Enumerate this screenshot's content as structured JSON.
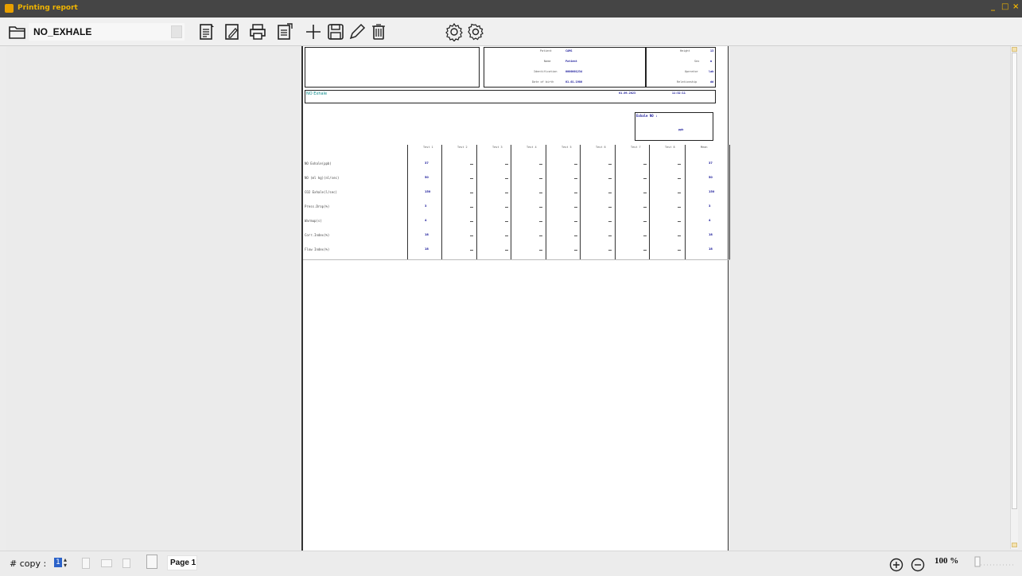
{
  "window": {
    "title": "Printing report",
    "controls": [
      "_",
      "□",
      "×"
    ]
  },
  "toolbar": {
    "report_name": "NO_EXHALE",
    "icons": [
      "folder-open-icon",
      "doc-text-icon",
      "doc-edit-icon",
      "printer-icon",
      "doc-export-icon",
      "plus-icon",
      "save-icon",
      "pencil-icon",
      "trash-icon",
      "settings-cog-icon",
      "settings-gear-icon"
    ]
  },
  "report": {
    "header_labels": {
      "r1": "Patient",
      "r2": "Name",
      "r3": "Identification",
      "r4": "Date of birth",
      "r5": "Height",
      "r6": "Sex",
      "r7": "Operator",
      "r8": "Relationship"
    },
    "header_values": {
      "v1": "CAMS",
      "v2": "Patient",
      "v3": "0000001234",
      "v4": "01.01.1980",
      "v5": "13",
      "v6": "m",
      "v7": "lab",
      "v8": "dd"
    },
    "section_title": "NO Exhale",
    "section_date": "01.09.2023",
    "section_time": "11:32:11",
    "result_label": "Exhale NO :",
    "result_unit": "ppb",
    "col_headers": [
      "Test 1",
      "Test 2",
      "Test 3",
      "Test 4",
      "Test 5",
      "Test 6",
      "Test 7",
      "Test 8",
      "Mean"
    ],
    "rows": [
      {
        "label": "NO Exhale(ppb)",
        "v1": "37",
        "mean": "37"
      },
      {
        "label": "NO (ml kg)(nl/sec)",
        "v1": "50",
        "mean": "50"
      },
      {
        "label": "CO2 Exhale(l/sec)",
        "v1": "150",
        "mean": "150"
      },
      {
        "label": "Press.Drop(%)",
        "v1": "3",
        "mean": "3"
      },
      {
        "label": "Warmup(s)",
        "v1": "4",
        "mean": "4"
      },
      {
        "label": "Corr.Index(%)",
        "v1": "18",
        "mean": "18"
      },
      {
        "label": "Flow Index(%)",
        "v1": "18",
        "mean": "18"
      }
    ],
    "dash": "—"
  },
  "statusbar": {
    "copy_label": "# copy :",
    "copy_value": "1",
    "page_label": "Page 1",
    "zoom": "100 %"
  }
}
